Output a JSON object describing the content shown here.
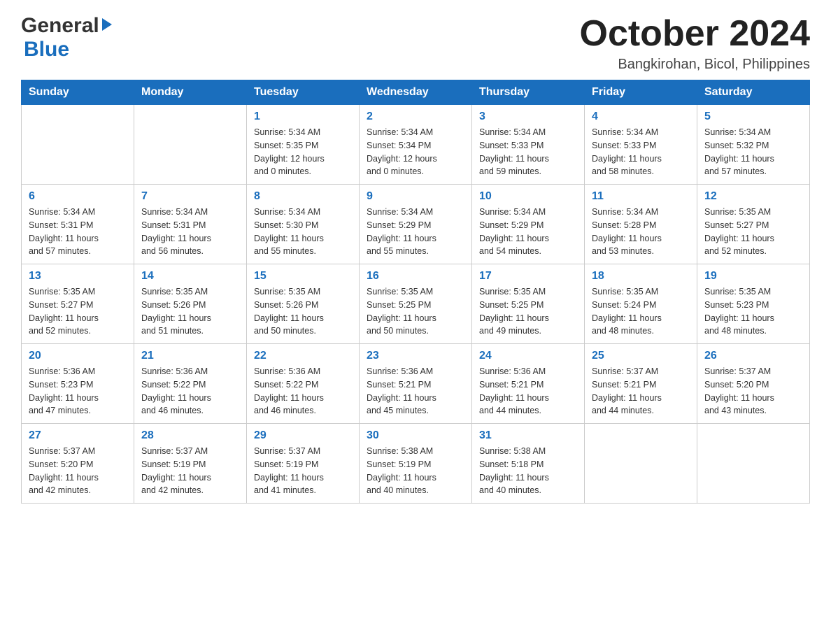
{
  "header": {
    "logo_general": "General",
    "logo_blue": "Blue",
    "month_title": "October 2024",
    "location": "Bangkirohan, Bicol, Philippines"
  },
  "days_of_week": [
    "Sunday",
    "Monday",
    "Tuesday",
    "Wednesday",
    "Thursday",
    "Friday",
    "Saturday"
  ],
  "weeks": [
    {
      "days": [
        {
          "number": "",
          "info": ""
        },
        {
          "number": "",
          "info": ""
        },
        {
          "number": "1",
          "info": "Sunrise: 5:34 AM\nSunset: 5:35 PM\nDaylight: 12 hours\nand 0 minutes."
        },
        {
          "number": "2",
          "info": "Sunrise: 5:34 AM\nSunset: 5:34 PM\nDaylight: 12 hours\nand 0 minutes."
        },
        {
          "number": "3",
          "info": "Sunrise: 5:34 AM\nSunset: 5:33 PM\nDaylight: 11 hours\nand 59 minutes."
        },
        {
          "number": "4",
          "info": "Sunrise: 5:34 AM\nSunset: 5:33 PM\nDaylight: 11 hours\nand 58 minutes."
        },
        {
          "number": "5",
          "info": "Sunrise: 5:34 AM\nSunset: 5:32 PM\nDaylight: 11 hours\nand 57 minutes."
        }
      ]
    },
    {
      "days": [
        {
          "number": "6",
          "info": "Sunrise: 5:34 AM\nSunset: 5:31 PM\nDaylight: 11 hours\nand 57 minutes."
        },
        {
          "number": "7",
          "info": "Sunrise: 5:34 AM\nSunset: 5:31 PM\nDaylight: 11 hours\nand 56 minutes."
        },
        {
          "number": "8",
          "info": "Sunrise: 5:34 AM\nSunset: 5:30 PM\nDaylight: 11 hours\nand 55 minutes."
        },
        {
          "number": "9",
          "info": "Sunrise: 5:34 AM\nSunset: 5:29 PM\nDaylight: 11 hours\nand 55 minutes."
        },
        {
          "number": "10",
          "info": "Sunrise: 5:34 AM\nSunset: 5:29 PM\nDaylight: 11 hours\nand 54 minutes."
        },
        {
          "number": "11",
          "info": "Sunrise: 5:34 AM\nSunset: 5:28 PM\nDaylight: 11 hours\nand 53 minutes."
        },
        {
          "number": "12",
          "info": "Sunrise: 5:35 AM\nSunset: 5:27 PM\nDaylight: 11 hours\nand 52 minutes."
        }
      ]
    },
    {
      "days": [
        {
          "number": "13",
          "info": "Sunrise: 5:35 AM\nSunset: 5:27 PM\nDaylight: 11 hours\nand 52 minutes."
        },
        {
          "number": "14",
          "info": "Sunrise: 5:35 AM\nSunset: 5:26 PM\nDaylight: 11 hours\nand 51 minutes."
        },
        {
          "number": "15",
          "info": "Sunrise: 5:35 AM\nSunset: 5:26 PM\nDaylight: 11 hours\nand 50 minutes."
        },
        {
          "number": "16",
          "info": "Sunrise: 5:35 AM\nSunset: 5:25 PM\nDaylight: 11 hours\nand 50 minutes."
        },
        {
          "number": "17",
          "info": "Sunrise: 5:35 AM\nSunset: 5:25 PM\nDaylight: 11 hours\nand 49 minutes."
        },
        {
          "number": "18",
          "info": "Sunrise: 5:35 AM\nSunset: 5:24 PM\nDaylight: 11 hours\nand 48 minutes."
        },
        {
          "number": "19",
          "info": "Sunrise: 5:35 AM\nSunset: 5:23 PM\nDaylight: 11 hours\nand 48 minutes."
        }
      ]
    },
    {
      "days": [
        {
          "number": "20",
          "info": "Sunrise: 5:36 AM\nSunset: 5:23 PM\nDaylight: 11 hours\nand 47 minutes."
        },
        {
          "number": "21",
          "info": "Sunrise: 5:36 AM\nSunset: 5:22 PM\nDaylight: 11 hours\nand 46 minutes."
        },
        {
          "number": "22",
          "info": "Sunrise: 5:36 AM\nSunset: 5:22 PM\nDaylight: 11 hours\nand 46 minutes."
        },
        {
          "number": "23",
          "info": "Sunrise: 5:36 AM\nSunset: 5:21 PM\nDaylight: 11 hours\nand 45 minutes."
        },
        {
          "number": "24",
          "info": "Sunrise: 5:36 AM\nSunset: 5:21 PM\nDaylight: 11 hours\nand 44 minutes."
        },
        {
          "number": "25",
          "info": "Sunrise: 5:37 AM\nSunset: 5:21 PM\nDaylight: 11 hours\nand 44 minutes."
        },
        {
          "number": "26",
          "info": "Sunrise: 5:37 AM\nSunset: 5:20 PM\nDaylight: 11 hours\nand 43 minutes."
        }
      ]
    },
    {
      "days": [
        {
          "number": "27",
          "info": "Sunrise: 5:37 AM\nSunset: 5:20 PM\nDaylight: 11 hours\nand 42 minutes."
        },
        {
          "number": "28",
          "info": "Sunrise: 5:37 AM\nSunset: 5:19 PM\nDaylight: 11 hours\nand 42 minutes."
        },
        {
          "number": "29",
          "info": "Sunrise: 5:37 AM\nSunset: 5:19 PM\nDaylight: 11 hours\nand 41 minutes."
        },
        {
          "number": "30",
          "info": "Sunrise: 5:38 AM\nSunset: 5:19 PM\nDaylight: 11 hours\nand 40 minutes."
        },
        {
          "number": "31",
          "info": "Sunrise: 5:38 AM\nSunset: 5:18 PM\nDaylight: 11 hours\nand 40 minutes."
        },
        {
          "number": "",
          "info": ""
        },
        {
          "number": "",
          "info": ""
        }
      ]
    }
  ]
}
